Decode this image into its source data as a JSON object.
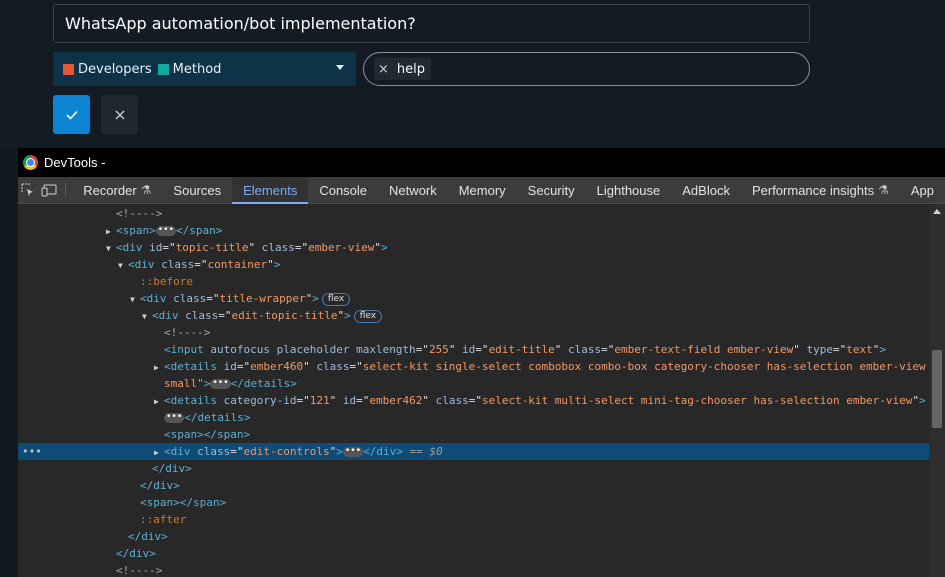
{
  "editor": {
    "title_value": "WhatsApp automation/bot implementation?",
    "category": {
      "parent": {
        "label": "Developers",
        "color": "#e45735"
      },
      "child": {
        "label": "Method",
        "color": "#12a89d"
      }
    },
    "tags": [
      {
        "label": "help",
        "remove_icon": "×"
      }
    ],
    "confirm_icon": "✓",
    "cancel_icon": "✕"
  },
  "devtools": {
    "window_title": "DevTools -",
    "tabs": [
      {
        "label": "Recorder",
        "flask": true
      },
      {
        "label": "Sources"
      },
      {
        "label": "Elements",
        "active": true
      },
      {
        "label": "Console"
      },
      {
        "label": "Network"
      },
      {
        "label": "Memory"
      },
      {
        "label": "Security"
      },
      {
        "label": "Lighthouse"
      },
      {
        "label": "AdBlock"
      },
      {
        "label": "Performance insights",
        "flask": true
      },
      {
        "label": "App"
      }
    ],
    "dom_lines": {
      "l1": "<!---->",
      "l2_open": "<span>",
      "l2_close": "</span>",
      "l3": {
        "tag": "div",
        "attrs": [
          [
            "id",
            "topic-title"
          ],
          [
            "class",
            "ember-view"
          ]
        ]
      },
      "l4": {
        "tag": "div",
        "attrs": [
          [
            "class",
            "container"
          ]
        ]
      },
      "l5": "::before",
      "l6": {
        "tag": "div",
        "attrs": [
          [
            "class",
            "title-wrapper"
          ]
        ],
        "badge": "flex"
      },
      "l7": {
        "tag": "div",
        "attrs": [
          [
            "class",
            "edit-topic-title"
          ]
        ],
        "badge": "flex"
      },
      "l8": "<!---->",
      "l9_tag": "input",
      "l9_bool": "autofocus placeholder",
      "l9_attrs": [
        [
          "maxlength",
          "255"
        ],
        [
          "id",
          "edit-title"
        ],
        [
          "class",
          "ember-text-field ember-view"
        ],
        [
          "type",
          "text"
        ]
      ],
      "l10_tag": "details",
      "l10_attrs": [
        [
          "id",
          "ember460"
        ],
        [
          "class",
          "select-kit single-select combobox combo-box category-chooser has-selection ember-view"
        ]
      ],
      "l10_wrap": "small\"",
      "l11_close": "</details>",
      "l12_tag": "details",
      "l12_attrs": [
        [
          "category-id",
          "121"
        ],
        [
          "id",
          "ember462"
        ],
        [
          "class",
          "select-kit multi-select mini-tag-chooser has-selection ember-view"
        ]
      ],
      "l13_close": "</details>",
      "l14": "<span></span>",
      "l15": {
        "tag": "div",
        "attrs": [
          [
            "class",
            "edit-controls"
          ]
        ],
        "close": "</div>",
        "marker": "== $0"
      },
      "l16": "</div>",
      "l17": "</div>",
      "l18": "<span></span>",
      "l19": "::after",
      "l20": "</div>",
      "l21": "</div>",
      "l22": "<!---->"
    }
  }
}
